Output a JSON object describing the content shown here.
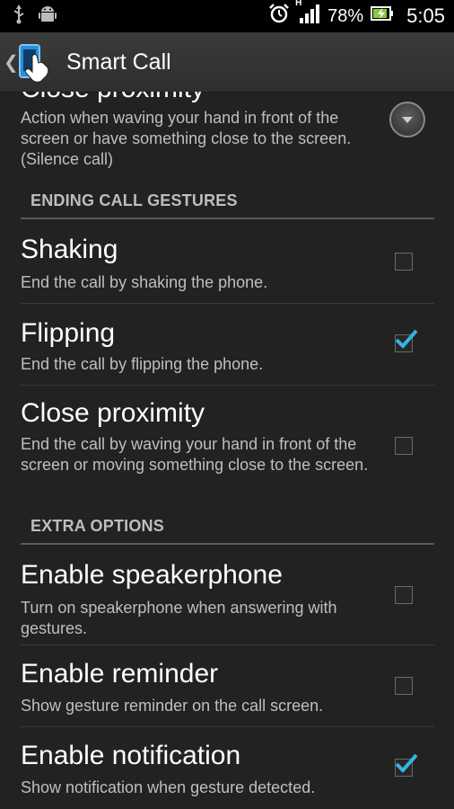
{
  "status_bar": {
    "battery": "78%",
    "time": "5:05",
    "network": "H",
    "icons": [
      "usb-icon",
      "android-icon",
      "alarm-icon",
      "signal-icon",
      "battery-icon"
    ]
  },
  "action_bar": {
    "title": "Smart Call",
    "icon": "smart-call-app-icon"
  },
  "accent_color": "#33b5e5",
  "proximity_partial": {
    "title": "Close proximity",
    "summary": "Action when waving your hand in front of the screen or have something close to the screen. (Silence call)"
  },
  "ending_category": {
    "label": "ENDING CALL GESTURES"
  },
  "ending_items": [
    {
      "title": "Shaking",
      "summary": "End the call by shaking the phone.",
      "checked": false
    },
    {
      "title": "Flipping",
      "summary": "End the call by flipping the phone.",
      "checked": true
    },
    {
      "title": "Close proximity",
      "summary": "End the call by waving your hand in front of the screen or moving something close to the screen.",
      "checked": false
    }
  ],
  "extra_category": {
    "label": "EXTRA OPTIONS"
  },
  "extra_items": [
    {
      "title": "Enable speakerphone",
      "summary": "Turn on speakerphone when answering with gestures.",
      "checked": false
    },
    {
      "title": "Enable reminder",
      "summary": "Show gesture reminder on the call screen.",
      "checked": false
    },
    {
      "title": "Enable notification",
      "summary": "Show notification when gesture detected.",
      "checked": true
    }
  ]
}
